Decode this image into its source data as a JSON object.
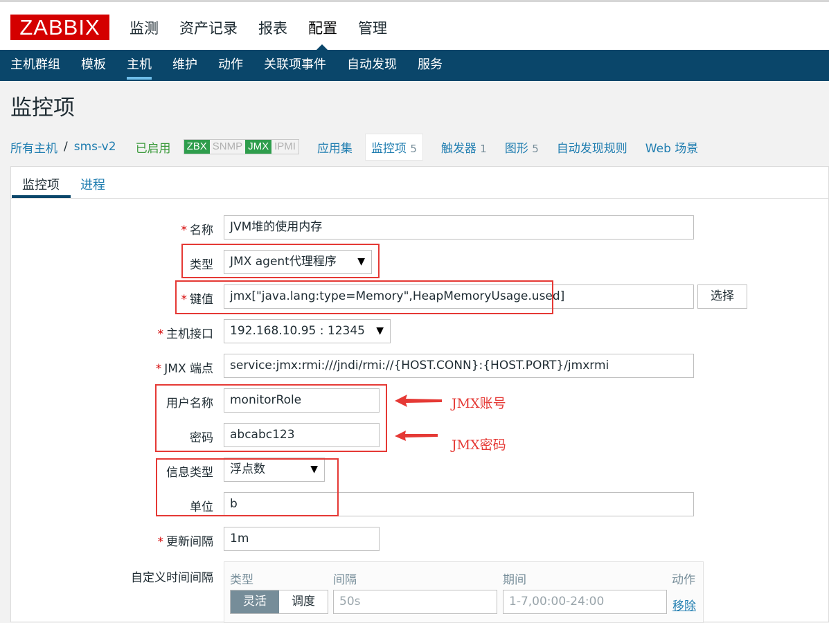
{
  "logo": "ZABBIX",
  "main_nav": [
    "监测",
    "资产记录",
    "报表",
    "配置",
    "管理"
  ],
  "sub_nav": [
    "主机群组",
    "模板",
    "主机",
    "维护",
    "动作",
    "关联项事件",
    "自动发现",
    "服务"
  ],
  "page_title": "监控项",
  "breadcrumb": {
    "all_hosts": "所有主机",
    "sep": "/",
    "host": "sms-v2"
  },
  "host_status": "已启用",
  "availability": [
    "ZBX",
    "SNMP",
    "JMX",
    "IPMI"
  ],
  "host_tabs": {
    "applications": "应用集",
    "items": "监控项",
    "items_count": "5",
    "triggers": "触发器",
    "triggers_count": "1",
    "graphs": "图形",
    "graphs_count": "5",
    "discovery": "自动发现规则",
    "web": "Web 场景"
  },
  "form_tabs": [
    "监控项",
    "进程"
  ],
  "form": {
    "name_label": "名称",
    "name_value": "JVM堆的使用内存",
    "type_label": "类型",
    "type_value": "JMX agent代理程序",
    "key_label": "键值",
    "key_value": "jmx[\"java.lang:type=Memory\",HeapMemoryUsage.used]",
    "select_button": "选择",
    "interface_label": "主机接口",
    "interface_value": "192.168.10.95 : 12345",
    "jmx_endpoint_label": "JMX 端点",
    "jmx_endpoint_value": "service:jmx:rmi:///jndi/rmi://{HOST.CONN}:{HOST.PORT}/jmxrmi",
    "username_label": "用户名称",
    "username_value": "monitorRole",
    "password_label": "密码",
    "password_value": "abcabc123",
    "info_type_label": "信息类型",
    "info_type_value": "浮点数",
    "units_label": "单位",
    "units_value": "b",
    "interval_label": "更新间隔",
    "interval_value": "1m",
    "custom_intervals_label": "自定义时间间隔",
    "required_mark": "*"
  },
  "schedule": {
    "col_type": "类型",
    "col_interval": "间隔",
    "col_period": "期间",
    "col_action": "动作",
    "type_flexible": "灵活",
    "type_scheduling": "调度",
    "interval_placeholder": "50s",
    "period_placeholder": "1-7,00:00-24:00",
    "remove": "移除"
  },
  "annotations": {
    "jmx_account": "JMX账号",
    "jmx_password": "JMX密码"
  },
  "colors": {
    "brand": "#d40000",
    "nav": "#0a466a",
    "link": "#1f7db0",
    "annotation": "#e53935"
  }
}
